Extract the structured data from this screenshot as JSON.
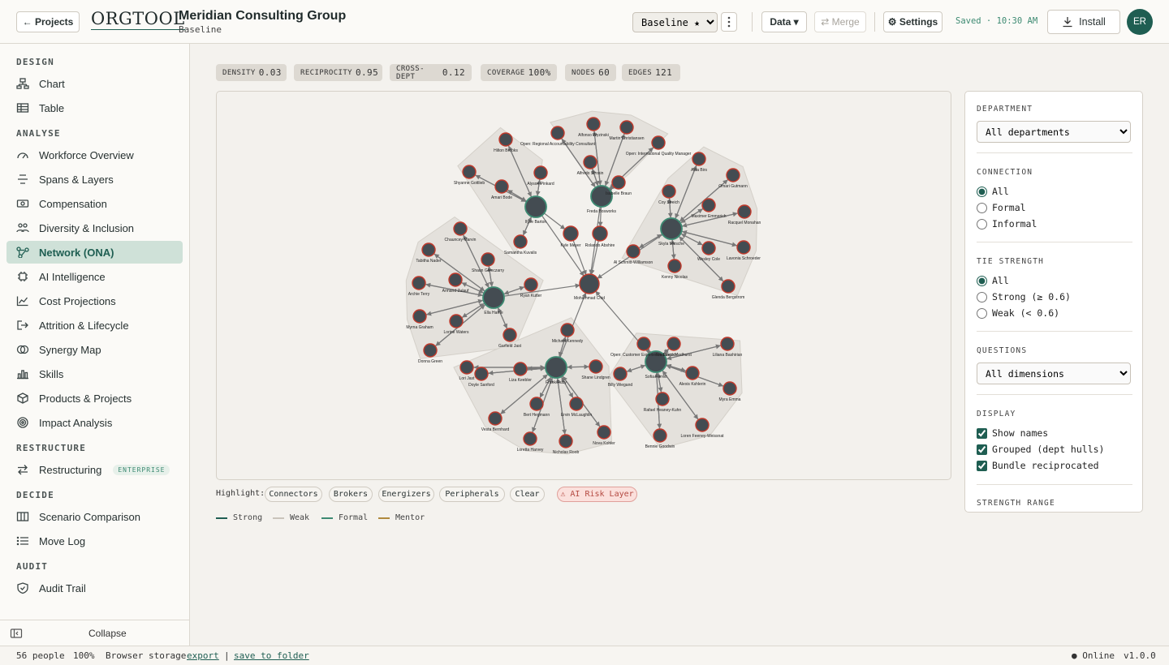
{
  "header": {
    "back_label": "← Projects",
    "logo": "ORGTOOL",
    "org_name": "Meridian Consulting Group",
    "org_sub": "Baseline",
    "scenario": "Baseline ★",
    "data_label": "Data ▾",
    "merge_label": "⇄ Merge",
    "settings_label": "⚙ Settings",
    "saved": "Saved · 10:30 AM",
    "install_label": "Install",
    "avatar": "ER"
  },
  "sidebar": {
    "sections": [
      {
        "title": "DESIGN",
        "items": [
          {
            "label": "Chart",
            "icon": "org-chart-icon"
          },
          {
            "label": "Table",
            "icon": "table-icon"
          }
        ]
      },
      {
        "title": "ANALYSE",
        "items": [
          {
            "label": "Workforce Overview",
            "icon": "gauge-icon"
          },
          {
            "label": "Spans & Layers",
            "icon": "layers-icon"
          },
          {
            "label": "Compensation",
            "icon": "banknote-icon"
          },
          {
            "label": "Diversity & Inclusion",
            "icon": "people-icon"
          },
          {
            "label": "Network (ONA)",
            "icon": "network-icon",
            "active": true
          },
          {
            "label": "AI Intelligence",
            "icon": "chip-icon"
          },
          {
            "label": "Cost Projections",
            "icon": "trend-icon"
          },
          {
            "label": "Attrition & Lifecycle",
            "icon": "exit-icon"
          },
          {
            "label": "Synergy Map",
            "icon": "overlap-icon"
          },
          {
            "label": "Skills",
            "icon": "bars-icon"
          },
          {
            "label": "Products & Projects",
            "icon": "box-icon"
          },
          {
            "label": "Impact Analysis",
            "icon": "target-icon"
          }
        ]
      },
      {
        "title": "RESTRUCTURE",
        "items": [
          {
            "label": "Restructuring",
            "icon": "swap-icon",
            "badge": "ENTERPRISE"
          }
        ]
      },
      {
        "title": "DECIDE",
        "items": [
          {
            "label": "Scenario Comparison",
            "icon": "columns-icon"
          },
          {
            "label": "Move Log",
            "icon": "list-icon"
          }
        ]
      },
      {
        "title": "AUDIT",
        "items": [
          {
            "label": "Audit Trail",
            "icon": "shield-icon"
          }
        ]
      }
    ],
    "collapse_label": "Collapse"
  },
  "metrics": [
    {
      "label": "DENSITY",
      "value": "0.03"
    },
    {
      "label": "RECIPROCITY",
      "value": "0.95"
    },
    {
      "label": "CROSS-DEPT",
      "value": "0.12"
    },
    {
      "label": "COVERAGE",
      "value": "100%"
    },
    {
      "label": "NODES",
      "value": "60"
    },
    {
      "label": "EDGES",
      "value": "121"
    }
  ],
  "highlight": {
    "label": "Highlight:",
    "buttons": [
      "Connectors",
      "Brokers",
      "Energizers",
      "Peripherals",
      "Clear"
    ],
    "risk": "⚠ AI Risk Layer"
  },
  "legend": [
    {
      "label": "Strong",
      "color": "#1f5e52"
    },
    {
      "label": "Weak",
      "color": "#c9c4bb"
    },
    {
      "label": "Formal",
      "color": "#3d8a72"
    },
    {
      "label": "Mentor",
      "color": "#b08a3e"
    }
  ],
  "panel": {
    "department_label": "DEPARTMENT",
    "department_value": "All departments",
    "connection_label": "CONNECTION",
    "connection_options": [
      "All",
      "Formal",
      "Informal"
    ],
    "tie_label": "TIE STRENGTH",
    "tie_options": [
      "All",
      "Strong (≥ 0.6)",
      "Weak (< 0.6)"
    ],
    "questions_label": "QUESTIONS",
    "questions_value": "All dimensions",
    "display_label": "DISPLAY",
    "display_options": [
      "Show names",
      "Grouped (dept hulls)",
      "Bundle reciprocated"
    ],
    "strength_label": "STRENGTH RANGE"
  },
  "status": {
    "people": "56 people",
    "zoom": "100%",
    "storage": "Browser storage",
    "export": "export",
    "sep": "|",
    "save": "save to folder",
    "online": "● Online",
    "version": "v1.0.0"
  },
  "network": {
    "center": "Mohammad Chid",
    "hubs": [
      {
        "name": "Ilyse Barton",
        "spokes": [
          "Hilton Brooks",
          "Shyanne Gottlieb",
          "Amari Bode",
          "Alyson Pinkard",
          "Samantha Kuvalis"
        ]
      },
      {
        "name": "Freda Bosworks",
        "spokes": [
          "Open: Regional Accountability Consultant",
          "Alfonso Wyzinski",
          "Martin Christiansen",
          "Open: International Quality Manager",
          "Alfredo Strosin",
          "Isabelle Braun"
        ]
      },
      {
        "name": "Skyla Mizsche",
        "spokes": [
          "Alda Birs",
          "Omari Gutmann",
          "Coy Streich",
          "Maximer Emmerich",
          "Racquel Monahan",
          "Al Schmitt-Williamson",
          "Lavonia Schroeder",
          "Wesley Cole",
          "Kenny Nicolas",
          "Glenda Bergstrom"
        ]
      },
      {
        "name": "Ella Harrie",
        "spokes": [
          "Chauncey Marvin",
          "Tabitha Nader",
          "Shaun Glenczarry",
          "Archie Terry",
          "Armand Zulauf",
          "Ryan Kutter",
          "Myrna Graham",
          "Lorine Waters",
          "Garfield Jast",
          "Donna Green"
        ]
      },
      {
        "name": "Frank Ruby",
        "spokes": [
          "Michael Kennedy",
          "Liza Keebler",
          "Shane Lindgren",
          "Lori Jast",
          "Doyle Sanford",
          "Bert Hegmann",
          "Ervin McLaughlin",
          "Vesta Bernhard",
          "Nova Kohler",
          "Loretta Harvey",
          "Nicholas Roob"
        ]
      },
      {
        "name": "Sofia Farrell",
        "spokes": [
          "Open: Customer Experience Director",
          "Francisco Medhurst",
          "Liliana Bashirian",
          "Billy Wiegand",
          "Alexis Kshlerin",
          "Myra Emma",
          "Rafael Heaney-Kuhn",
          "Loren Feeney-Weissnat",
          "Bennie Goodwin"
        ]
      }
    ]
  }
}
